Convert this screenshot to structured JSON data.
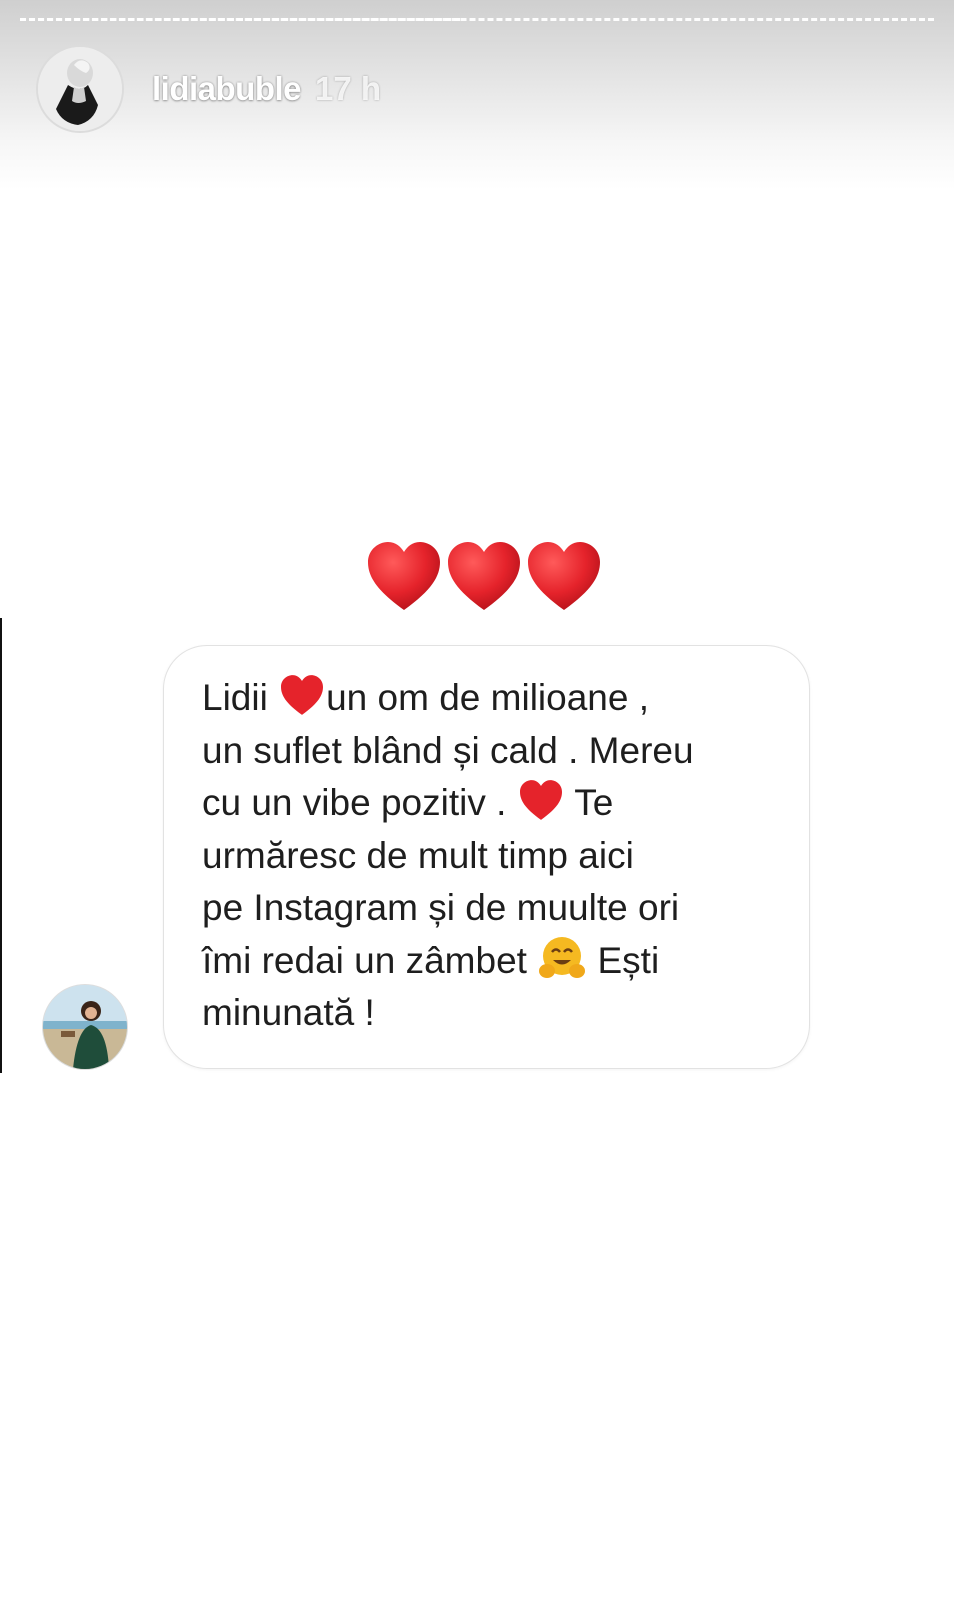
{
  "story": {
    "username": "lidiabuble",
    "time_ago": "17 h",
    "colors": {
      "heart": "#e5232b",
      "text": "#1e1e1e",
      "bubble_border": "#e2e2e2"
    }
  },
  "sticker": {
    "hearts_count": 3,
    "message": {
      "line1_a": "Lidii",
      "line1_b": "un om de milioane ,",
      "line2": "un suflet blând și cald . Mereu",
      "line3_a": "cu un vibe pozitiv .",
      "line3_b": "Te",
      "line4": "urmăresc de mult timp aici",
      "line5": "pe Instagram și de muulte ori",
      "line6_a": "îmi redai un zâmbet",
      "line6_b": "Ești",
      "line7": "minunată !"
    },
    "icons": [
      "heart-icon",
      "hugging-face-icon"
    ]
  }
}
